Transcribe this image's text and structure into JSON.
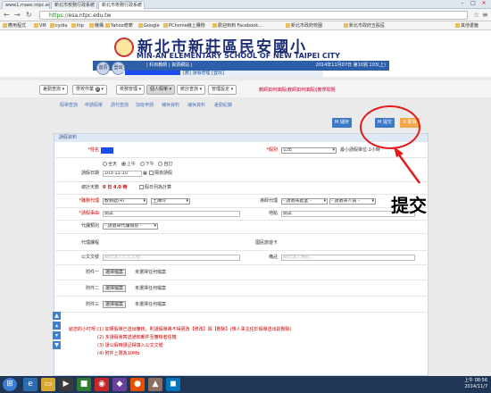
{
  "browser": {
    "tabs": [
      {
        "label": "www1.maes.ntpc.edu.tw"
      },
      {
        "label": "新北市校務行政系統"
      },
      {
        "label": "新北市校務行政系統"
      }
    ],
    "url_scheme": "https://",
    "url_rest": "esa.ntpc.edu.tw",
    "bookmarks": [
      "應用程式",
      "VM",
      "cydia",
      "itip",
      "機構",
      "Yahoo奇摩",
      "Google",
      "PChome線上購物",
      "歡迎到到 Facebook...",
      "新北市政府校園",
      "新北市政府五股區",
      "其他書籤"
    ]
  },
  "banner": {
    "school_cn": "新北市新莊區民安國小",
    "school_en": "MIN-AN ELEMENTARY SCHOOL OF NEW TAIPEI CITY",
    "hotlinks": "| 科目教師 | 資源網站 |",
    "date": "2014年11月07日 第10週 103(上)",
    "home_btn": "首頁",
    "logout_btn": "登出",
    "user_role": "[教] 請假管理 [登出]"
  },
  "menu": {
    "items": [
      "差勤查詢",
      "學校作業",
      "校務管理",
      "個人假單",
      "統計查詢",
      "管理設定"
    ],
    "badge": "0",
    "link": "教師如何填假(教師如何填假)|教學問題"
  },
  "breadcrumb": [
    "假單查詢",
    "申請假單",
    "請代查詢",
    "加班申請",
    "補休資料",
    "補休資料",
    "差勤紀錄"
  ],
  "actions": {
    "save": "M 儲存",
    "submit": "M 提交",
    "cancel": "X 取消"
  },
  "form": {
    "panel_title": "請假資料",
    "name_label": "*姓名",
    "type_label": "*假別",
    "type_value": "公出",
    "type_note": "最小請假單位:1小時",
    "date_label": "請假日期",
    "period_options": [
      "全天",
      "上午",
      "下午",
      "自訂"
    ],
    "date_value": "103-11-10",
    "overnight_label": "隔夜請假",
    "days_label": "總計天數",
    "days_value": "0 日 4.0 時",
    "holiday_label": "假日列為計算",
    "proxy_label": "*職務代理",
    "proxy_dept": "教務處(4)",
    "proxy_person": "王陳玲",
    "tz_label": "導師代理",
    "tz_dept": "- 請選擇處室 -",
    "tz_person": "- 請選擇人員 -",
    "reason_label": "*請假事由",
    "reason_value": "測試",
    "place_label": "地點",
    "place_value": "測試",
    "class_label": "代課類別",
    "class_value": "- 請選擇代課類別 -",
    "sub_label": "代理課程",
    "trip_label": "國民旅遊卡",
    "doc_label": "公文文號",
    "doc_placeholder": "點此填入公文文號...",
    "remark_label": "備註",
    "remark_placeholder": "點此填入備註...",
    "attach_labels": [
      "附件一",
      "附件二",
      "附件三"
    ],
    "file_btn": "選擇檔案",
    "file_status": "未選擇任何檔案",
    "notes_title": "給您的小叮嚀：",
    "notes": [
      "(1) 如果假單已送出審核，則請假單將不得更改【修改】與【刪除】(惟人事主任於假單送出前刪除)",
      "(2) 多請假會寄送通知郵件至審核者信箱",
      "(3) 請公假時請記得填入公文文號",
      "(4) 附件上限為10Mb"
    ]
  },
  "annotation": {
    "label": "提交",
    "color": "#e31c1c"
  },
  "taskbar": {
    "time": "上午 08:56",
    "date": "2014/11/7"
  }
}
